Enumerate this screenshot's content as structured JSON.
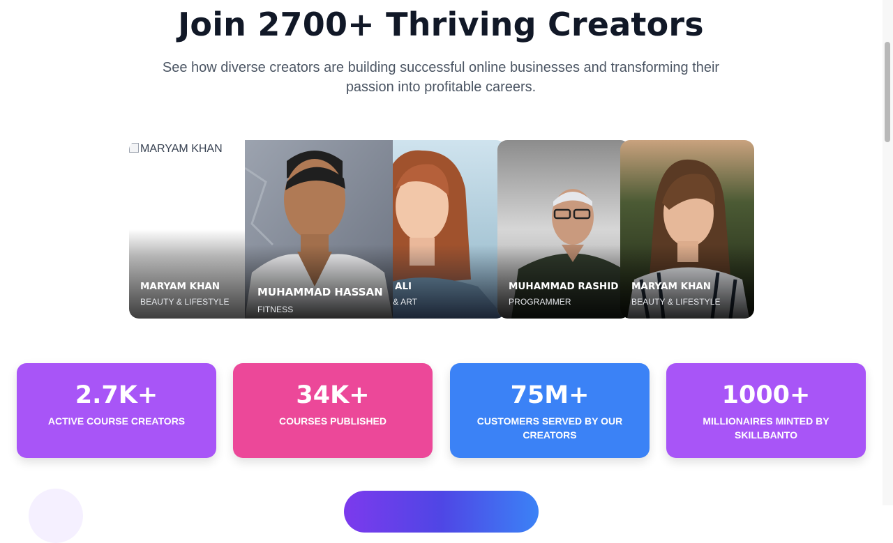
{
  "section": {
    "title": "Join 2700+ Thriving Creators",
    "subtitle": "See how diverse creators are building successful online businesses and transforming their passion into profitable careers."
  },
  "creators": [
    {
      "name": "MARYAM KHAN",
      "category": "BEAUTY & LIFESTYLE",
      "image_alt": "MARYAM KHAN",
      "image_broken": true
    },
    {
      "name": "MUHAMMAD HASSAN",
      "category": "FITNESS"
    },
    {
      "name": "IMRA ALI",
      "category": "ESIGN & ART"
    },
    {
      "name": "MUHAMMAD RASHID",
      "category": "PROGRAMMER"
    },
    {
      "name": "MARYAM KHAN",
      "category": "BEAUTY & LIFESTYLE"
    }
  ],
  "stats": [
    {
      "value": "2.7K+",
      "label": "ACTIVE COURSE CREATORS",
      "color": "#a855f7"
    },
    {
      "value": "34K+",
      "label": "COURSES PUBLISHED",
      "color": "#ec4899"
    },
    {
      "value": "75M+",
      "label": "CUSTOMERS SERVED BY OUR CREATORS",
      "color": "#3b82f6"
    },
    {
      "value": "1000+",
      "label": "MILLIONAIRES MINTED BY SKILLBANTO",
      "color": "#a855f7"
    }
  ],
  "colors": {
    "heading": "#111827",
    "subtitle": "#4b5563",
    "cta_gradient_start": "#7c3aed",
    "cta_gradient_end": "#3b82f6"
  }
}
